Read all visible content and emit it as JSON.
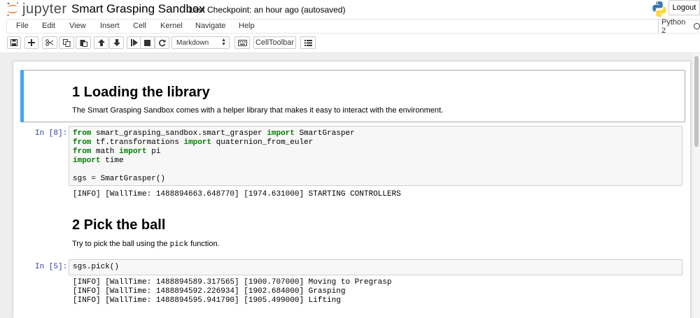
{
  "header": {
    "logo_text": "jupyter",
    "notebook_title": "Smart Grasping Sandbox",
    "checkpoint": "Last Checkpoint: an hour ago (autosaved)",
    "logout_label": "Logout"
  },
  "menubar": {
    "items": [
      "File",
      "Edit",
      "View",
      "Insert",
      "Cell",
      "Kernel",
      "Navigate",
      "Help"
    ],
    "kernel_name": "Python 2"
  },
  "toolbar": {
    "cell_type": "Markdown",
    "celltoolbar_label": "CellToolbar",
    "icons": [
      "save-icon",
      "plus-icon",
      "scissors-icon",
      "copy-icon",
      "paste-icon",
      "arrow-up-icon",
      "arrow-down-icon",
      "step-forward-icon",
      "stop-icon",
      "restart-icon",
      "keyboard-icon",
      "list-icon"
    ]
  },
  "cells": {
    "md1": {
      "heading": "1  Loading the library",
      "text": "The Smart Grasping Sandbox comes with a helper library that makes it easy to interact with the environment."
    },
    "code1": {
      "prompt": "In [8]:",
      "lines": [
        {
          "kw1": "from",
          "t1": " smart_grasping_sandbox.smart_grasper ",
          "kw2": "import",
          "t2": " SmartGrasper"
        },
        {
          "kw1": "from",
          "t1": " tf.transformations ",
          "kw2": "import",
          "t2": " quaternion_from_euler"
        },
        {
          "kw1": "from",
          "t1": " math ",
          "kw2": "import",
          "t2": " pi"
        },
        {
          "kw1": "import",
          "t1": " time",
          "kw2": "",
          "t2": ""
        },
        {
          "kw1": "",
          "t1": "",
          "kw2": "",
          "t2": ""
        },
        {
          "kw1": "",
          "t1": "sgs = SmartGrasper()",
          "kw2": "",
          "t2": ""
        }
      ],
      "output": [
        "[INFO] [WallTime: 1488894663.648770] [1974.631000] STARTING CONTROLLERS"
      ]
    },
    "md2": {
      "heading": "2  Pick the ball",
      "text_before": "Try to pick the ball using the ",
      "text_code": "pick",
      "text_after": " function."
    },
    "code2": {
      "prompt": "In [5]:",
      "line": "sgs.pick()",
      "output": [
        "[INFO] [WallTime: 1488894589.317565] [1900.707000] Moving to Pregrasp",
        "[INFO] [WallTime: 1488894592.226934] [1902.684000] Grasping",
        "[INFO] [WallTime: 1488894595.941790] [1905.499000] Lifting"
      ]
    }
  },
  "colors": {
    "selected_cell_bar": "#42a5f5",
    "prompt": "#303f9f",
    "keyword": "#008000",
    "jupyter_orange": "#f37726"
  }
}
